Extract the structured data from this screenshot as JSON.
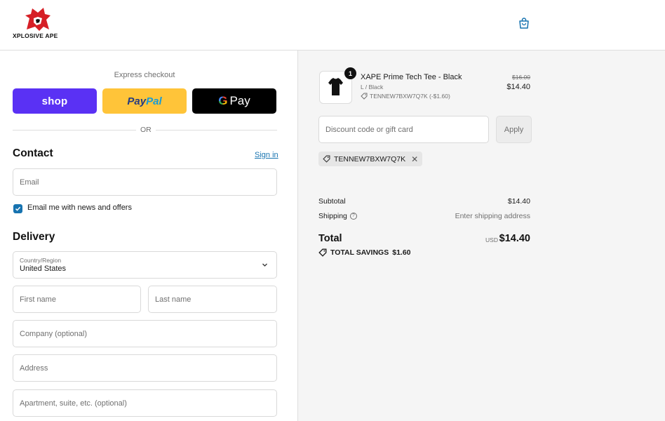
{
  "header": {
    "brand_name": "XPLOSIVE APE",
    "cart_icon": "shopping-bag-icon"
  },
  "express": {
    "title": "Express checkout",
    "shop_label": "shop",
    "paypal_label_a": "Pay",
    "paypal_label_b": "Pal",
    "gpay_g": "G",
    "gpay_label": "Pay",
    "or_label": "OR"
  },
  "contact": {
    "heading": "Contact",
    "signin_label": "Sign in",
    "email_placeholder": "Email",
    "newsletter_label": "Email me with news and offers",
    "newsletter_checked": true
  },
  "delivery": {
    "heading": "Delivery",
    "country_label": "Country/Region",
    "country_value": "United States",
    "first_name_placeholder": "First name",
    "last_name_placeholder": "Last name",
    "company_placeholder": "Company (optional)",
    "address_placeholder": "Address",
    "apartment_placeholder": "Apartment, suite, etc. (optional)"
  },
  "order": {
    "item": {
      "quantity": "1",
      "title": "XAPE Prime Tech Tee - Black",
      "variant": "L / Black",
      "discount_line": "TENNEW7BXW7Q7K (-$1.60)",
      "original_price": "$16.00",
      "price": "$14.40"
    },
    "discount_placeholder": "Discount code or gift card",
    "apply_label": "Apply",
    "applied_code": "TENNEW7BXW7Q7K",
    "subtotal_label": "Subtotal",
    "subtotal_value": "$14.40",
    "shipping_label": "Shipping",
    "shipping_value": "Enter shipping address",
    "total_label": "Total",
    "total_currency": "USD",
    "total_value": "$14.40",
    "savings_label": "TOTAL SAVINGS",
    "savings_value": "$1.60"
  },
  "colors": {
    "accent": "#1773b0",
    "shop_pay": "#5a31f4",
    "paypal": "#ffc439",
    "summary_bg": "#f5f5f5"
  }
}
